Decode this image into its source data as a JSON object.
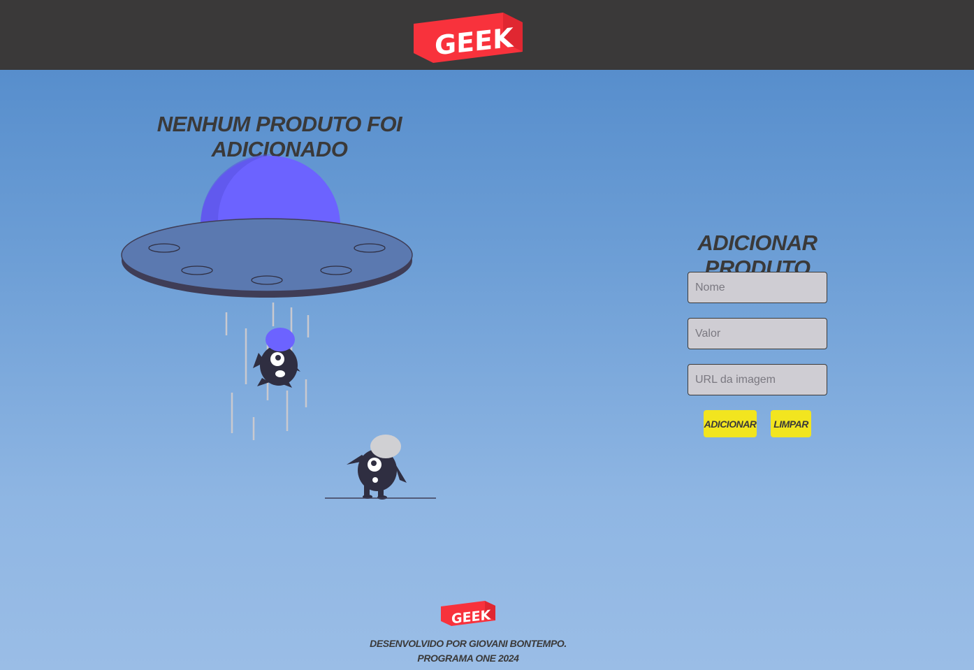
{
  "header": {
    "logo_text": "GEEK"
  },
  "products": {
    "empty_message": "Nenhum produto foi adicionado"
  },
  "form": {
    "title": "Adicionar produto",
    "name_placeholder": "Nome",
    "price_placeholder": "Valor",
    "image_placeholder": "URL da imagem",
    "add_label": "Adicionar",
    "clear_label": "Limpar"
  },
  "footer": {
    "logo_text": "GEEK",
    "credit": "Desenvolvido por Giovani Bontempo.",
    "program": "Programa ONE 2024"
  },
  "colors": {
    "header_bg": "#3a3939",
    "logo_red": "#f8323c",
    "button_yellow": "#f2e51f",
    "ufo_dome": "#6c63ff",
    "text_dark": "#3a3939"
  }
}
